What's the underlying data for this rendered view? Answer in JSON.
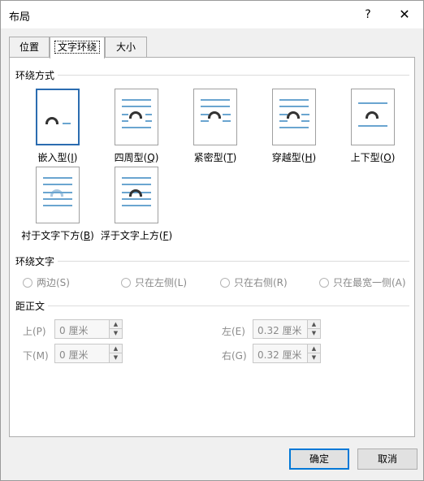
{
  "window": {
    "title": "布局",
    "help": "?",
    "close": "✕"
  },
  "tabs": [
    {
      "label": "位置"
    },
    {
      "label": "文字环绕"
    },
    {
      "label": "大小"
    }
  ],
  "wrapping_style": {
    "title": "环绕方式",
    "options": [
      {
        "text": "嵌入型(",
        "key": "I",
        "suffix": ")"
      },
      {
        "text": "四周型(",
        "key": "Q",
        "suffix": ")"
      },
      {
        "text": "紧密型(",
        "key": "T",
        "suffix": ")"
      },
      {
        "text": "穿越型(",
        "key": "H",
        "suffix": ")"
      },
      {
        "text": "上下型(",
        "key": "O",
        "suffix": ")"
      },
      {
        "text": "衬于文字下方(",
        "key": "B",
        "suffix": ")"
      },
      {
        "text": "浮于文字上方(",
        "key": "F",
        "suffix": ")"
      }
    ]
  },
  "wrap_text": {
    "title": "环绕文字",
    "options": [
      "两边(S)",
      "只在左侧(L)",
      "只在右侧(R)",
      "只在最宽一侧(A)"
    ]
  },
  "distance": {
    "title": "距正文",
    "top_label": "上(P)",
    "top_value": "0 厘米",
    "bottom_label": "下(M)",
    "bottom_value": "0 厘米",
    "left_label": "左(E)",
    "left_value": "0.32 厘米",
    "right_label": "右(G)",
    "right_value": "0.32 厘米"
  },
  "buttons": {
    "ok": "确定",
    "cancel": "取消"
  },
  "colors": {
    "accent": "#0078d7",
    "line_blue": "#6aa5d0"
  }
}
